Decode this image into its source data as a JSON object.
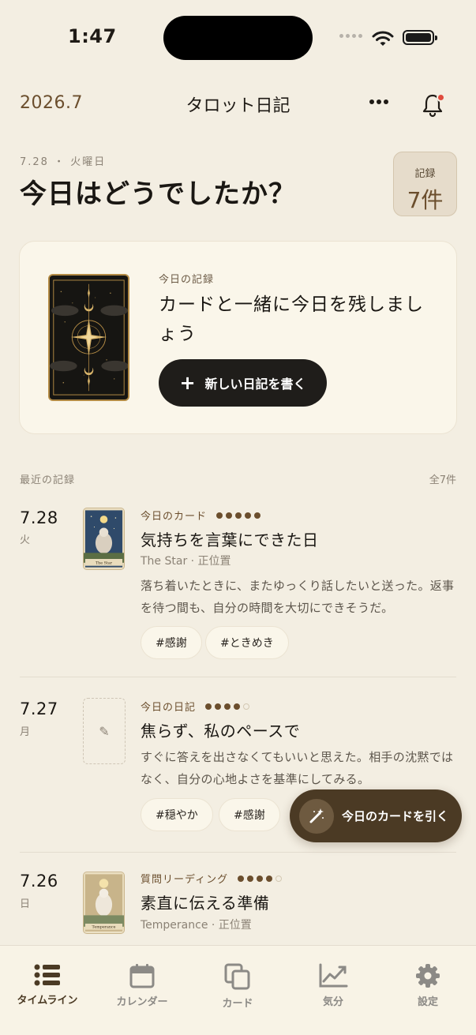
{
  "status_bar": {
    "time": "1:47"
  },
  "header": {
    "month": "2026.7",
    "title": "タロット日記",
    "more_icon": "ellipsis-icon",
    "bell_icon": "bell-icon",
    "accent_color": "#6b4e2d",
    "notification_color": "#e04b3e"
  },
  "greeting": {
    "date": "7.28 ・ 火曜日",
    "headline": "今日はどうでしたか？",
    "count_label": "記録",
    "count_value": "7件"
  },
  "today_card": {
    "eyebrow": "今日の記録",
    "message": "カードと一緒に今日を残しましょう",
    "button_label": "新しい日記を書く",
    "button_icon": "plus-icon"
  },
  "recent": {
    "label": "最近の記録",
    "total": "全7件"
  },
  "entries": [
    {
      "day": "7.28",
      "weekday": "火",
      "eyebrow": "今日のカード",
      "rating": 5,
      "rating_max": 5,
      "title": "気持ちを言葉にできた日",
      "card": "The Star · 正位置",
      "body": "落ち着いたときに、またゆっくり話したいと送った。返事を待つ間も、自分の時間を大切にできそうだ。",
      "tags": [
        "#感謝",
        "#ときめき"
      ],
      "thumb_caption": "The Star"
    },
    {
      "day": "7.27",
      "weekday": "月",
      "eyebrow": "今日の日記",
      "rating": 4,
      "rating_max": 5,
      "title": "焦らず、私のペースで",
      "card": "",
      "body": "すぐに答えを出さなくてもいいと思えた。相手の沈黙ではなく、自分の心地よさを基準にしてみる。",
      "tags": [
        "#穏やか",
        "#感謝"
      ]
    },
    {
      "day": "7.26",
      "weekday": "日",
      "eyebrow": "質問リーディング",
      "rating": 4,
      "rating_max": 5,
      "title": "素直に伝える準備",
      "card": "Temperance · 正位置",
      "thumb_caption": "Temperance"
    }
  ],
  "fab": {
    "label": "今日のカードを引く",
    "icon": "magic-wand-icon"
  },
  "tabs": [
    {
      "label": "タイムライン",
      "icon": "list-icon",
      "active": true
    },
    {
      "label": "カレンダー",
      "icon": "calendar-icon",
      "active": false
    },
    {
      "label": "カード",
      "icon": "cards-icon",
      "active": false
    },
    {
      "label": "気分",
      "icon": "chart-icon",
      "active": false
    },
    {
      "label": "設定",
      "icon": "gear-icon",
      "active": false
    }
  ]
}
